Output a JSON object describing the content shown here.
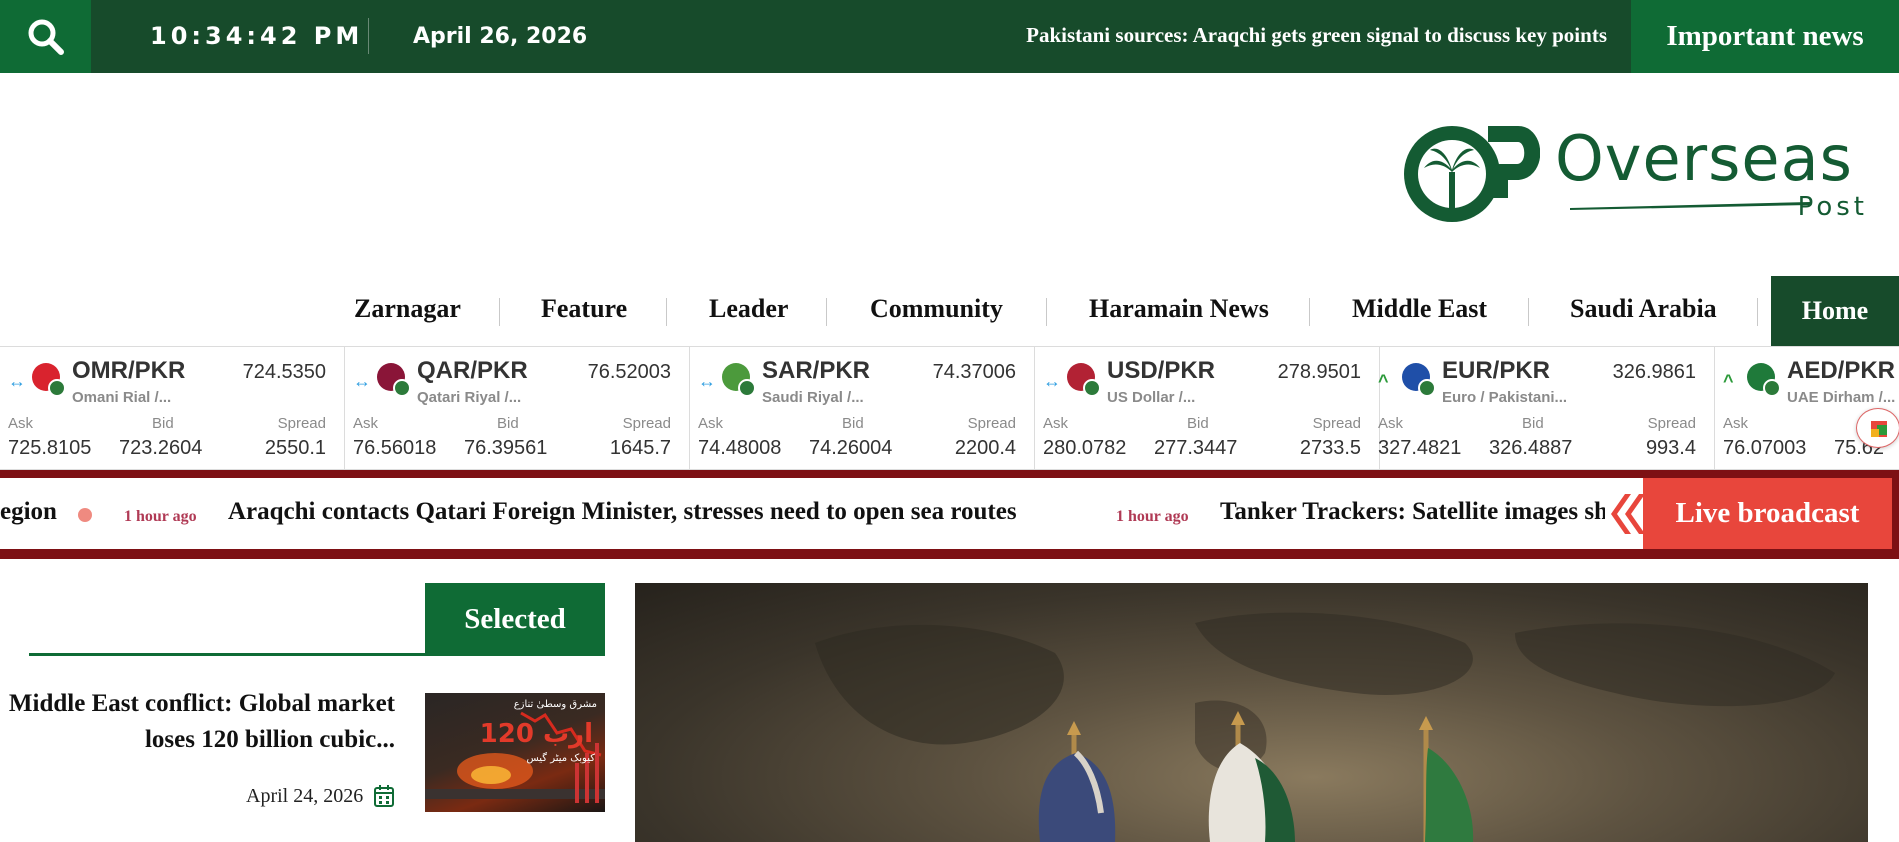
{
  "topbar": {
    "time": "10:34:42 PM",
    "date": "April 26, 2026",
    "headline": "Pakistani sources: Araqchi gets green signal to discuss key points",
    "important_label": "Important news"
  },
  "logo": {
    "word": "Overseas",
    "sub": "Post"
  },
  "nav": {
    "items": [
      "Zarnagar",
      "Feature",
      "Leader",
      "Community",
      "Haramain News",
      "Middle East",
      "Saudi Arabia"
    ],
    "home": "Home"
  },
  "fx": {
    "labels": {
      "ask": "Ask",
      "bid": "Bid",
      "spread": "Spread"
    },
    "cards": [
      {
        "pair": "OMR/PKR",
        "name": "Omani Rial /...",
        "rate": "724.5350",
        "ask": "725.8105",
        "bid": "723.2604",
        "spread": "2550.1",
        "trend": "↔",
        "trend_color": "#2f9ee0",
        "flag_color": "#d9232e"
      },
      {
        "pair": "QAR/PKR",
        "name": "Qatari Riyal /...",
        "rate": "76.52003",
        "ask": "76.56018",
        "bid": "76.39561",
        "spread": "1645.7",
        "trend": "↔",
        "trend_color": "#2f9ee0",
        "flag_color": "#8a1538"
      },
      {
        "pair": "SAR/PKR",
        "name": "Saudi Riyal /...",
        "rate": "74.37006",
        "ask": "74.48008",
        "bid": "74.26004",
        "spread": "2200.4",
        "trend": "↔",
        "trend_color": "#2f9ee0",
        "flag_color": "#4c9a3c"
      },
      {
        "pair": "USD/PKR",
        "name": "US Dollar /...",
        "rate": "278.9501",
        "ask": "280.0782",
        "bid": "277.3447",
        "spread": "2733.5",
        "trend": "↔",
        "trend_color": "#2f9ee0",
        "flag_color": "#b22234"
      },
      {
        "pair": "EUR/PKR",
        "name": "Euro / Pakistani...",
        "rate": "326.9861",
        "ask": "327.4821",
        "bid": "326.4887",
        "spread": "993.4",
        "trend": "^",
        "trend_color": "#2c9a3a",
        "flag_color": "#1f4fa8"
      },
      {
        "pair": "AED/PKR",
        "name": "UAE Dirham /...",
        "rate": "",
        "ask": "76.07003",
        "bid": "75.62",
        "spread": "",
        "trend": "^",
        "trend_color": "#2c9a3a",
        "flag_color": "#1f7a3a"
      }
    ]
  },
  "ticker": {
    "frag_left": "egion",
    "time1": "1 hour ago",
    "item1": "Araqchi contacts Qatari Foreign Minister, stresses need to open sea routes",
    "time2": "1 hour ago",
    "item2": "Tanker Trackers: Satellite images sh",
    "live_label": "Live broadcast"
  },
  "selected": {
    "tab_label": "Selected",
    "article": {
      "title": "Middle East conflict: Global market loses 120 billion cubic...",
      "date": "April 24, 2026",
      "thumb_line1": "مشرق وسطیٰ تنازع",
      "thumb_line2": "120 ارب",
      "thumb_line3": "کیوبک میٹر گیس"
    }
  },
  "colors": {
    "topbar": "#174b2b",
    "accent_green": "#0f6b35",
    "live_red": "#e8463c",
    "ticker_border": "#7d1014"
  }
}
